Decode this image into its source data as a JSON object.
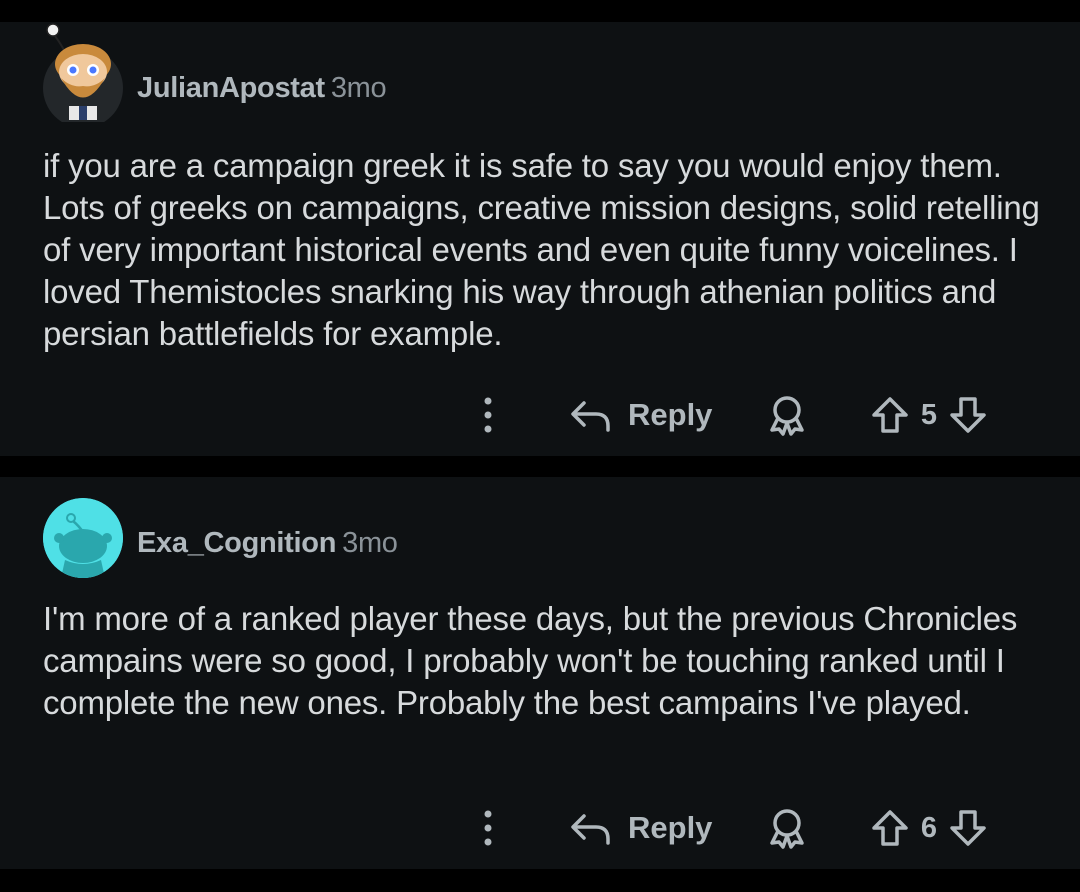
{
  "comments": [
    {
      "author": "JulianApostat",
      "time": "3mo",
      "body": "if you are a campaign greek it is safe to say you would enjoy them. Lots of greeks on campaigns, creative mission designs, solid retelling of very important historical events and even quite funny voicelines. I loved Themistocles snarking his way through athenian politics and persian battlefields for example.",
      "reply_label": "Reply",
      "score": "5",
      "avatar": "bearded-snoo-avatar"
    },
    {
      "author": "Exa_Cognition",
      "time": "3mo",
      "body": "I'm more of a ranked player these days, but the previous Chronicles campains were so good, I probably won't be touching ranked until I complete the new ones. Probably the best campains I've played.",
      "reply_label": "Reply",
      "score": "6",
      "avatar": "default-snoo-avatar"
    }
  ],
  "colors": {
    "background": "#000000",
    "card": "#0e1113",
    "text": "#d7dadc",
    "muted": "#b0b8bd",
    "avatar_default": "#4fe0e6"
  }
}
